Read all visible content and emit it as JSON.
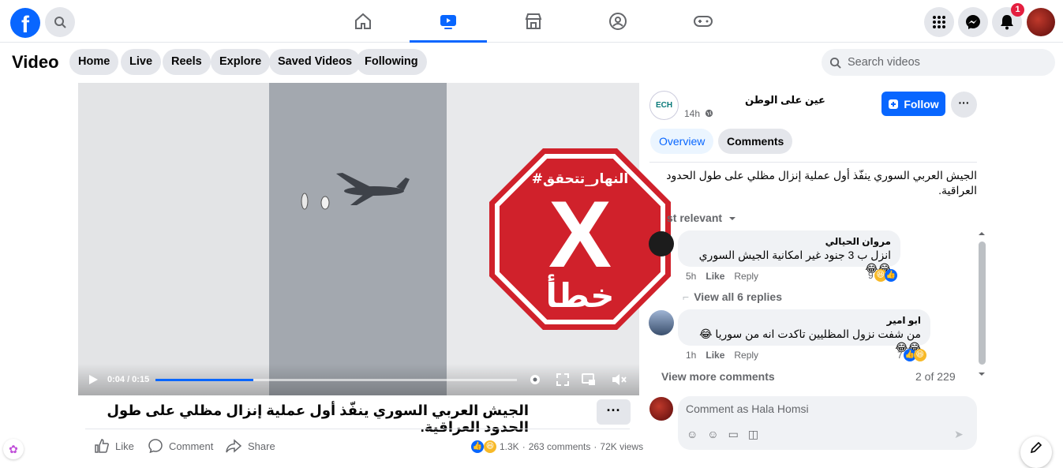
{
  "topnav": {
    "logo": "f",
    "notifications_count": "1",
    "nav_tabs": [
      "home-icon",
      "video-icon",
      "marketplace-icon",
      "groups-icon",
      "gaming-icon"
    ]
  },
  "subnav": {
    "title": "Video",
    "pills": [
      "Home",
      "Live",
      "Reels",
      "Explore",
      "Saved Videos",
      "Following"
    ],
    "search_placeholder": "Search videos"
  },
  "video": {
    "current_time": "0:04 / 0:15",
    "progress": 0.27,
    "stamp_hashtag": "#النهار_تتحقق",
    "stamp_verdict": "خطأ",
    "stamp_mark": "X"
  },
  "post": {
    "title": "الجيش العربي السوري ينفّذ أول عملية إنزال مظلي على طول الحدود العراقية.",
    "more": "···",
    "actions": {
      "like": "Like",
      "comment": "Comment",
      "share": "Share"
    },
    "reactions_count": "1.3K",
    "comments_count": "263 comments",
    "views_count": "72K views",
    "stats_sep": "·"
  },
  "page": {
    "name": "عين على الوطن",
    "avatar_text": "ECH",
    "time": "14h",
    "follow_label": "Follow",
    "more": "···"
  },
  "tabs": {
    "overview": "Overview",
    "comments": "Comments"
  },
  "description": "الجيش العربي السوري ينفّذ أول عملية إنزال مظلي على طول الحدود العراقية.",
  "sort_label": "st relevant",
  "comments": [
    {
      "name": "مروان الحيالي",
      "text": "انزل ب 3 جنود غير امكانية الجيش السوري 😂😂",
      "time": "5h",
      "like": "Like",
      "reply": "Reply",
      "reactions": "9"
    },
    {
      "name": "ابو امير",
      "text": "من شفت نزول المظليين تاكدت انه من سوريا 😂😂😂",
      "time": "1h",
      "like": "Like",
      "reply": "Reply",
      "reactions": "7"
    }
  ],
  "view_replies": "View all 6 replies",
  "view_more": "View more comments",
  "comment_count": "2 of 229",
  "composer": {
    "placeholder": "Comment as Hala Homsi"
  },
  "colors": {
    "brand": "#0866ff",
    "stamp_red": "#d0212b",
    "badge": "#e41e3f"
  }
}
